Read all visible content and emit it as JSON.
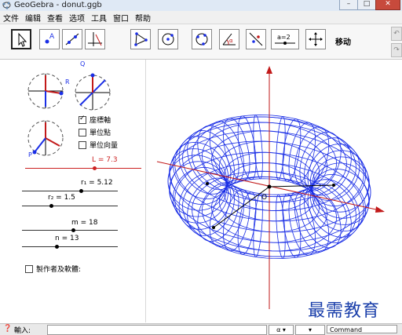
{
  "window": {
    "title": "GeoGebra - donut.ggb"
  },
  "menu": [
    "文件",
    "编辑",
    "查看",
    "选项",
    "工具",
    "窗口",
    "帮助"
  ],
  "toolbar": {
    "active_label": "移动",
    "a2_text": "a=2",
    "point_text": "A"
  },
  "labels": {
    "q": "Q",
    "r": "R",
    "p": "P",
    "o": "O"
  },
  "checkboxes": [
    {
      "label": "座標軸",
      "checked": true
    },
    {
      "label": "單位點",
      "checked": false
    },
    {
      "label": "單位向量",
      "checked": false
    }
  ],
  "sliders": {
    "L": {
      "label": "L = 7.3"
    },
    "r1": {
      "label": "r₁ = 5.12"
    },
    "r2": {
      "label": "r₂ = 1.5"
    },
    "m": {
      "label": "m = 18"
    },
    "n": {
      "label": "n = 13"
    }
  },
  "author_checkbox": "製作者及軟體:",
  "input_bar": {
    "prefix": "輸入:",
    "command": "Command"
  },
  "watermark": "最需教育",
  "colors": {
    "torus": "#1a2ee6",
    "axis_red": "#c21a1a"
  }
}
